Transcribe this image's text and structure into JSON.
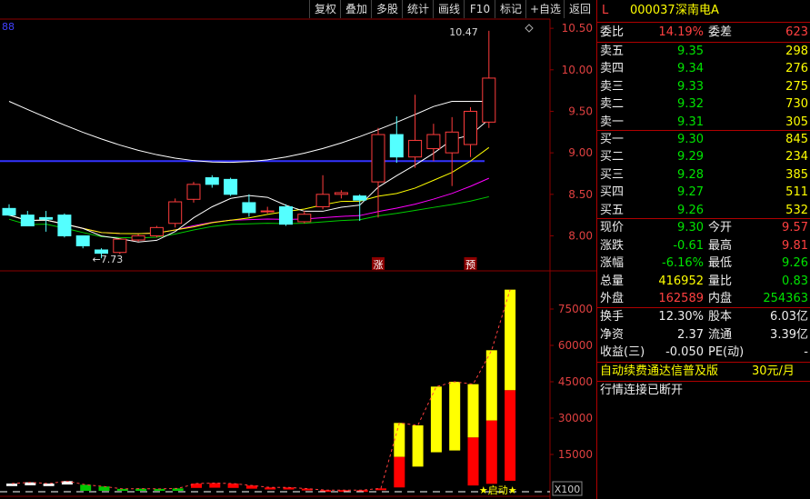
{
  "toolbar": [
    "复权",
    "叠加",
    "多股",
    "统计",
    "画线",
    "F10",
    "标记",
    "+自选",
    "返回"
  ],
  "chart_corner_value": "88",
  "price_axis": [
    "10.50",
    "10.00",
    "9.50",
    "9.00",
    "8.50",
    "8.00"
  ],
  "volume_axis": [
    "75000",
    "60000",
    "45000",
    "30000",
    "15000"
  ],
  "volume_unit": "X100",
  "annotations": {
    "high": "10.47",
    "low": "7.73",
    "mark1": "涨",
    "mark2": "预",
    "start": "★启动★"
  },
  "colors": {
    "up": "#ff3c3c",
    "down": "#54ffff",
    "ma5": "#ffffff",
    "ma10": "#ffff00",
    "ma20": "#ff00ff",
    "ma60": "#00cc00",
    "ma_long": "#ffffff",
    "hline": "#3333ff",
    "grid": "#8b0000",
    "vol_yellow": "#ffff00",
    "vol_red": "#ff0000"
  },
  "chart_data": {
    "type": "candlestick",
    "price_ylim": [
      7.6,
      10.6
    ],
    "candles": [
      {
        "o": 8.33,
        "h": 8.38,
        "l": 8.24,
        "c": 8.25
      },
      {
        "o": 8.25,
        "h": 8.3,
        "l": 8.12,
        "c": 8.12
      },
      {
        "o": 8.22,
        "h": 8.3,
        "l": 8.05,
        "c": 8.2
      },
      {
        "o": 8.25,
        "h": 8.27,
        "l": 7.98,
        "c": 8.0
      },
      {
        "o": 8.0,
        "h": 8.0,
        "l": 7.85,
        "c": 7.88
      },
      {
        "o": 7.83,
        "h": 7.85,
        "l": 7.73,
        "c": 7.79
      },
      {
        "o": 7.8,
        "h": 7.97,
        "l": 7.78,
        "c": 7.96
      },
      {
        "o": 7.95,
        "h": 8.02,
        "l": 7.93,
        "c": 8.0
      },
      {
        "o": 8.0,
        "h": 8.12,
        "l": 7.98,
        "c": 8.1
      },
      {
        "o": 8.15,
        "h": 8.45,
        "l": 8.1,
        "c": 8.41
      },
      {
        "o": 8.44,
        "h": 8.65,
        "l": 8.4,
        "c": 8.62
      },
      {
        "o": 8.7,
        "h": 8.73,
        "l": 8.58,
        "c": 8.62
      },
      {
        "o": 8.68,
        "h": 8.7,
        "l": 8.48,
        "c": 8.5
      },
      {
        "o": 8.4,
        "h": 8.5,
        "l": 8.23,
        "c": 8.28
      },
      {
        "o": 8.3,
        "h": 8.35,
        "l": 8.27,
        "c": 8.3
      },
      {
        "o": 8.35,
        "h": 8.38,
        "l": 8.12,
        "c": 8.14
      },
      {
        "o": 8.17,
        "h": 8.3,
        "l": 8.15,
        "c": 8.26
      },
      {
        "o": 8.35,
        "h": 8.73,
        "l": 8.32,
        "c": 8.5
      },
      {
        "o": 8.5,
        "h": 8.55,
        "l": 8.45,
        "c": 8.52
      },
      {
        "o": 8.48,
        "h": 8.5,
        "l": 8.18,
        "c": 8.43
      },
      {
        "o": 8.65,
        "h": 9.3,
        "l": 8.22,
        "c": 9.22
      },
      {
        "o": 9.22,
        "h": 9.44,
        "l": 8.88,
        "c": 8.95
      },
      {
        "o": 8.95,
        "h": 9.7,
        "l": 8.82,
        "c": 9.15
      },
      {
        "o": 9.05,
        "h": 9.35,
        "l": 8.9,
        "c": 9.22
      },
      {
        "o": 9.0,
        "h": 9.43,
        "l": 8.6,
        "c": 9.25
      },
      {
        "o": 9.1,
        "h": 9.55,
        "l": 8.95,
        "c": 9.5
      },
      {
        "o": 9.37,
        "h": 10.47,
        "l": 9.3,
        "c": 9.9
      }
    ],
    "volume_ylim": [
      0,
      90000
    ],
    "volumes": [
      3000,
      3500,
      3000,
      4000,
      2500,
      1800,
      800,
      900,
      800,
      1000,
      3000,
      3200,
      3000,
      2200,
      1400,
      1400,
      900,
      300,
      300,
      300,
      1000,
      28000,
      27000,
      43000,
      45000,
      44000,
      58000,
      83000
    ],
    "volume_cycles": [
      "white",
      "white",
      "white",
      "white",
      "green",
      "green",
      "green",
      "green",
      "green",
      "green",
      "red",
      "red",
      "red",
      "red",
      "red",
      "red",
      "red",
      "red",
      "red",
      "red",
      "red",
      "mixed",
      "yellow",
      "yellow",
      "yellow",
      "mixed",
      "mixed",
      "mixed"
    ]
  },
  "quote": {
    "title_marker": "L",
    "code": "000037",
    "name": "深南电A",
    "weibi_label": "委比",
    "weibi": "14.19%",
    "weicha_label": "委差",
    "weicha": "623",
    "asks": [
      {
        "label": "卖五",
        "price": "9.35",
        "vol": "298"
      },
      {
        "label": "卖四",
        "price": "9.34",
        "vol": "276"
      },
      {
        "label": "卖三",
        "price": "9.33",
        "vol": "275"
      },
      {
        "label": "卖二",
        "price": "9.32",
        "vol": "730"
      },
      {
        "label": "卖一",
        "price": "9.31",
        "vol": "305"
      }
    ],
    "bids": [
      {
        "label": "买一",
        "price": "9.30",
        "vol": "845"
      },
      {
        "label": "买二",
        "price": "9.29",
        "vol": "234"
      },
      {
        "label": "买三",
        "price": "9.28",
        "vol": "385"
      },
      {
        "label": "买四",
        "price": "9.27",
        "vol": "511"
      },
      {
        "label": "买五",
        "price": "9.26",
        "vol": "532"
      }
    ],
    "stats": [
      {
        "l1": "现价",
        "v1": "9.30",
        "l2": "今开",
        "v2": "9.57"
      },
      {
        "l1": "涨跌",
        "v1": "-0.61",
        "l2": "最高",
        "v2": "9.81"
      },
      {
        "l1": "涨幅",
        "v1": "-6.16%",
        "l2": "最低",
        "v2": "9.26"
      },
      {
        "l1": "总量",
        "v1": "416952",
        "l2": "量比",
        "v2": "0.83"
      },
      {
        "l1": "外盘",
        "v1": "162589",
        "l2": "内盘",
        "v2": "254363"
      }
    ],
    "fund": [
      {
        "l1": "换手",
        "v1": "12.30%",
        "l2": "股本",
        "v2": "6.03亿"
      },
      {
        "l1": "净资",
        "v1": "2.37",
        "l2": "流通",
        "v2": "3.39亿"
      },
      {
        "l1": "收益(三)",
        "v1": "-0.050",
        "l2": "PE(动)",
        "v2": "-"
      }
    ],
    "promo": "自动续费通达信普及版",
    "promo_price": "30元/月",
    "status": "行情连接已断开"
  }
}
